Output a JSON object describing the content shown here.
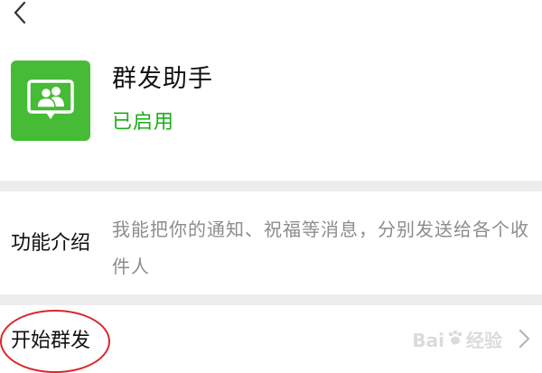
{
  "app": {
    "name": "群发助手",
    "status": "已启用",
    "icon": "group-message-icon",
    "accent_color": "#46bb36",
    "status_color": "#1aad19"
  },
  "intro": {
    "label": "功能介绍",
    "description": "我能把你的通知、祝福等消息，分别发送给各个收件人"
  },
  "actions": {
    "start_label": "开始群发"
  },
  "watermark": {
    "text": "Bai",
    "text2": "经验"
  },
  "icons": {
    "back": "chevron-left-icon",
    "forward": "chevron-right-icon"
  },
  "annotation": {
    "highlight_color": "#d9262b"
  }
}
